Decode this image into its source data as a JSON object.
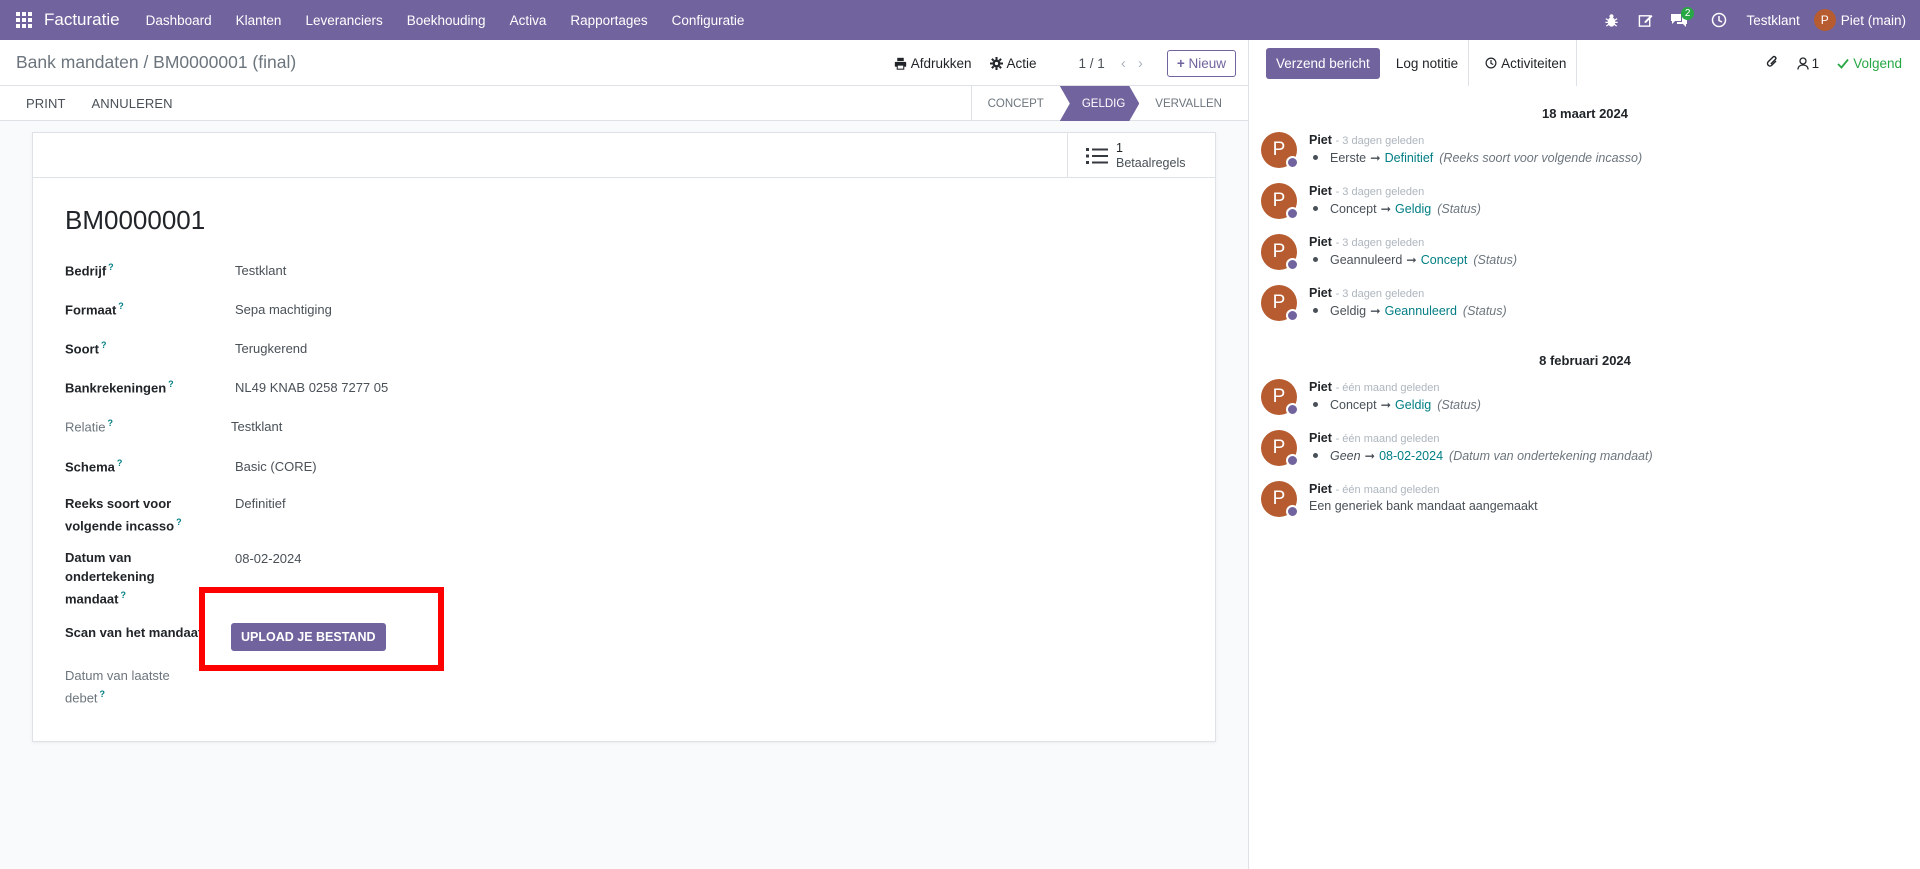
{
  "navbar": {
    "app_name": "Facturatie",
    "menu": [
      "Dashboard",
      "Klanten",
      "Leveranciers",
      "Boekhouding",
      "Activa",
      "Rapportages",
      "Configuratie"
    ],
    "message_count": "2",
    "company": "Testklant",
    "user_initial": "P",
    "user": "Piet (main)"
  },
  "control_panel": {
    "breadcrumb": "Bank mandaten / BM0000001 (final)",
    "print_label": "Afdrukken",
    "action_label": "Actie",
    "pager": "1 / 1",
    "new_label": "Nieuw"
  },
  "statusbar": {
    "buttons": [
      "PRINT",
      "ANNULEREN"
    ],
    "stages": [
      "CONCEPT",
      "GELDIG",
      "VERVALLEN"
    ],
    "active_stage": "GELDIG"
  },
  "smart_button": {
    "count": "1",
    "label": "Betaalregels"
  },
  "record": {
    "title": "BM0000001",
    "fields": [
      {
        "label": "Bedrijf",
        "value": "Testklant"
      },
      {
        "label": "Formaat",
        "value": "Sepa machtiging"
      },
      {
        "label": "Soort",
        "value": "Terugkerend"
      },
      {
        "label": "Bankrekeningen",
        "value": "NL49 KNAB 0258 7277 05"
      },
      {
        "label": "Relatie",
        "value": "Testklant"
      },
      {
        "label": "Schema",
        "value": "Basic (CORE)"
      },
      {
        "label": "Reeks soort voor volgende incasso",
        "value": "Definitief"
      },
      {
        "label": "Datum van ondertekening mandaat",
        "value": "08-02-2024"
      },
      {
        "label": "Scan van het mandaat",
        "value": "UPLOAD JE BESTAND"
      },
      {
        "label": "Datum van laatste debet",
        "value": ""
      }
    ]
  },
  "chatter": {
    "send_label": "Verzend bericht",
    "log_label": "Log notitie",
    "activities_label": "Activiteiten",
    "follower_count": "1",
    "follow_label": "Volgend",
    "groups": [
      {
        "date": "18 maart 2024",
        "messages": [
          {
            "author": "Piet",
            "time": "- 3 dagen geleden",
            "old": "Eerste",
            "new": "Definitief",
            "field": "(Reeks soort voor volgende incasso)"
          },
          {
            "author": "Piet",
            "time": "- 3 dagen geleden",
            "old": "Concept",
            "new": "Geldig",
            "field": "(Status)"
          },
          {
            "author": "Piet",
            "time": "- 3 dagen geleden",
            "old": "Geannuleerd",
            "new": "Concept",
            "field": "(Status)"
          },
          {
            "author": "Piet",
            "time": "- 3 dagen geleden",
            "old": "Geldig",
            "new": "Geannuleerd",
            "field": "(Status)"
          }
        ]
      },
      {
        "date": "8 februari 2024",
        "messages": [
          {
            "author": "Piet",
            "time": "- één maand geleden",
            "old": "Concept",
            "new": "Geldig",
            "field": "(Status)"
          },
          {
            "author": "Piet",
            "time": "- één maand geleden",
            "old": "Geen",
            "new": "08-02-2024",
            "field": "(Datum van ondertekening mandaat)"
          },
          {
            "author": "Piet",
            "time": "- één maand geleden",
            "text": "Een generiek bank mandaat aangemaakt"
          }
        ]
      }
    ]
  },
  "colors": {
    "brand": "#71639e",
    "link": "#017e84",
    "follow": "#28a745",
    "avatar": "#b65c30",
    "highlight": "#ff0000"
  }
}
